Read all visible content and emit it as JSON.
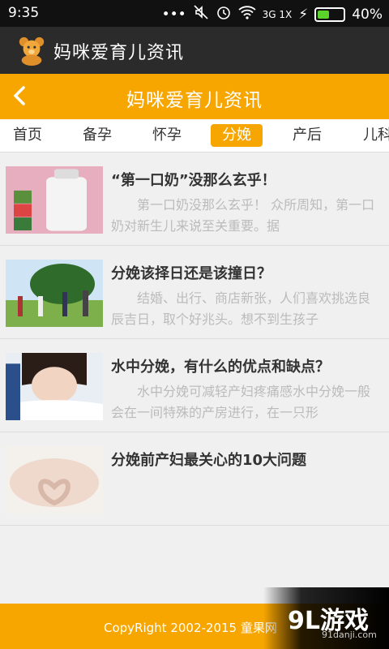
{
  "status_bar": {
    "time": "9:35",
    "network": "3G 1X",
    "battery_percent": "40%",
    "battery_level": 0.4
  },
  "app_bar": {
    "title": "妈咪爱育儿资讯",
    "logo_icon": "teddy-bear-icon"
  },
  "header": {
    "title": "妈咪爱育儿资讯",
    "back_icon": "chevron-left-icon"
  },
  "tabs": [
    {
      "label": "首页"
    },
    {
      "label": "备孕"
    },
    {
      "label": "怀孕"
    },
    {
      "label": "分娩",
      "active": true
    },
    {
      "label": "产后"
    },
    {
      "label": "儿科"
    }
  ],
  "articles": [
    {
      "title": "“第一口奶”没那么玄乎！",
      "summary": "第一口奶没那么玄乎！ 众所周知，第一口奶对新生儿来说至关重要。据"
    },
    {
      "title": "分娩该择日还是该撞日？",
      "summary": "结婚、出行、商店新张，人们喜欢挑选良辰吉日，取个好兆头。想不到生孩子"
    },
    {
      "title": "水中分娩，有什么的优点和缺点？",
      "summary": "水中分娩可减轻产妇疼痛感水中分娩一般会在一间特殊的产房进行，在一只形"
    },
    {
      "title": "分娩前产妇最关心的10大问题",
      "summary": ""
    }
  ],
  "footer": {
    "copyright": "CopyRight 2002-2015 童果网"
  },
  "watermark": {
    "brand": "9L游戏",
    "site": "91danji.com"
  },
  "colors": {
    "accent": "#f7a600",
    "app_bar": "#2b2b2b",
    "status_bar": "#111111"
  }
}
